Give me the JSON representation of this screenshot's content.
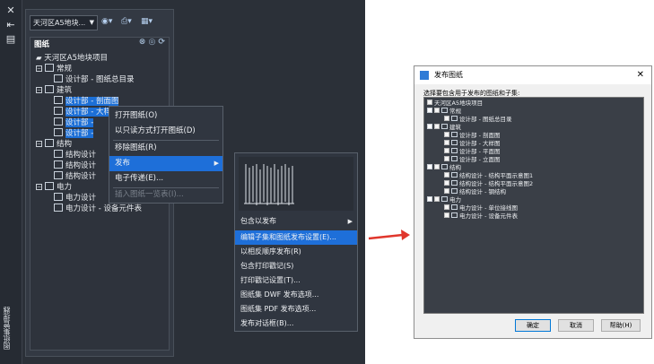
{
  "sidebar": {
    "close_icon": "close-icon",
    "pin_icon": "autohide-icon",
    "props_icon": "properties-icon",
    "vertical_title": "图纸集管理器"
  },
  "palette": {
    "combo_value": "天河区A5地块...",
    "header_title": "图纸",
    "tree": {
      "root": "天河区A5地块项目",
      "groups": [
        {
          "label": "常规",
          "items": [
            "设计部 - 图纸总目录"
          ]
        },
        {
          "label": "建筑",
          "items": [
            "设计部 - 剖面图",
            "设计部 - 大样图",
            "设计部 - ",
            "设计部 - "
          ]
        },
        {
          "label": "结构",
          "items": [
            "结构设计",
            "结构设计",
            "结构设计"
          ]
        },
        {
          "label": "电力",
          "items": [
            "电力设计",
            "电力设计 - 设备元件表"
          ]
        }
      ]
    }
  },
  "context_menu": {
    "items": [
      "打开图纸(O)",
      "以只读方式打开图纸(D)",
      "移除图纸(R)",
      "发布",
      "电子传递(E)...",
      "插入图纸一览表(I)..."
    ]
  },
  "publish_submenu": {
    "items": [
      "包含以发布",
      "编辑子集和图纸发布设置(E)...",
      "以相反顺序发布(R)",
      "包含打印戳记(S)",
      "打印戳记设置(T)...",
      "图纸集 DWF 发布选项...",
      "图纸集 PDF 发布选项...",
      "发布对话框(B)..."
    ]
  },
  "dialog": {
    "title": "发布图纸",
    "instruction": "选择要包含用于发布的图纸和子集:",
    "tree": {
      "root": "天河区A5地块项目",
      "groups": [
        {
          "label": "常规",
          "items": [
            "设计部 - 图纸总目录"
          ]
        },
        {
          "label": "建筑",
          "items": [
            "设计部 - 剖面图",
            "设计部 - 大样图",
            "设计部 - 平面图",
            "设计部 - 立面图"
          ]
        },
        {
          "label": "结构",
          "items": [
            "结构设计 - 结构平面示意图1",
            "结构设计 - 结构平面示意图2",
            "结构设计 - 钢结构"
          ]
        },
        {
          "label": "电力",
          "items": [
            "电力设计 - 单位接线图",
            "电力设计 - 设备元件表"
          ]
        }
      ]
    },
    "buttons": {
      "ok": "确定",
      "cancel": "取消",
      "help": "帮助(H)"
    }
  },
  "colors": {
    "accent": "#1e6fd9",
    "arrow": "#e0362c"
  }
}
